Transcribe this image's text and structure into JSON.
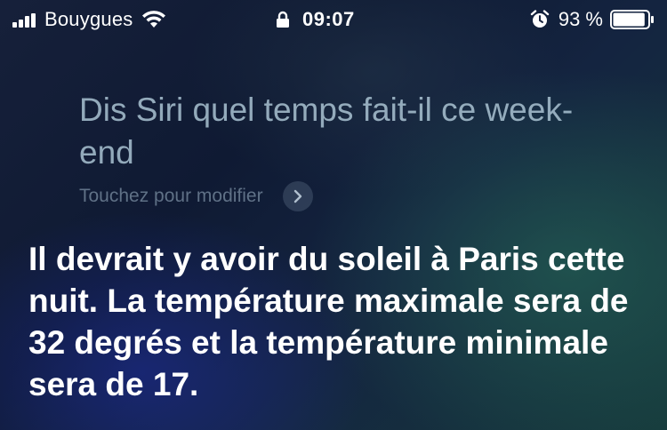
{
  "status_bar": {
    "carrier": "Bouygues",
    "time": "09:07",
    "battery_percent": "93 %",
    "battery_level": 0.93,
    "icons": [
      "signal-icon",
      "wifi-icon",
      "lock-icon",
      "alarm-icon",
      "battery-icon"
    ]
  },
  "siri": {
    "query": "Dis Siri quel temps fait-il ce week-end",
    "edit_label": "Touchez pour modifier",
    "edit_icon": "chevron-right-icon",
    "response": "Il devrait y avoir du soleil à Paris cette nuit. La température maximale sera de 32 degrés et la température minimale sera de 17."
  }
}
